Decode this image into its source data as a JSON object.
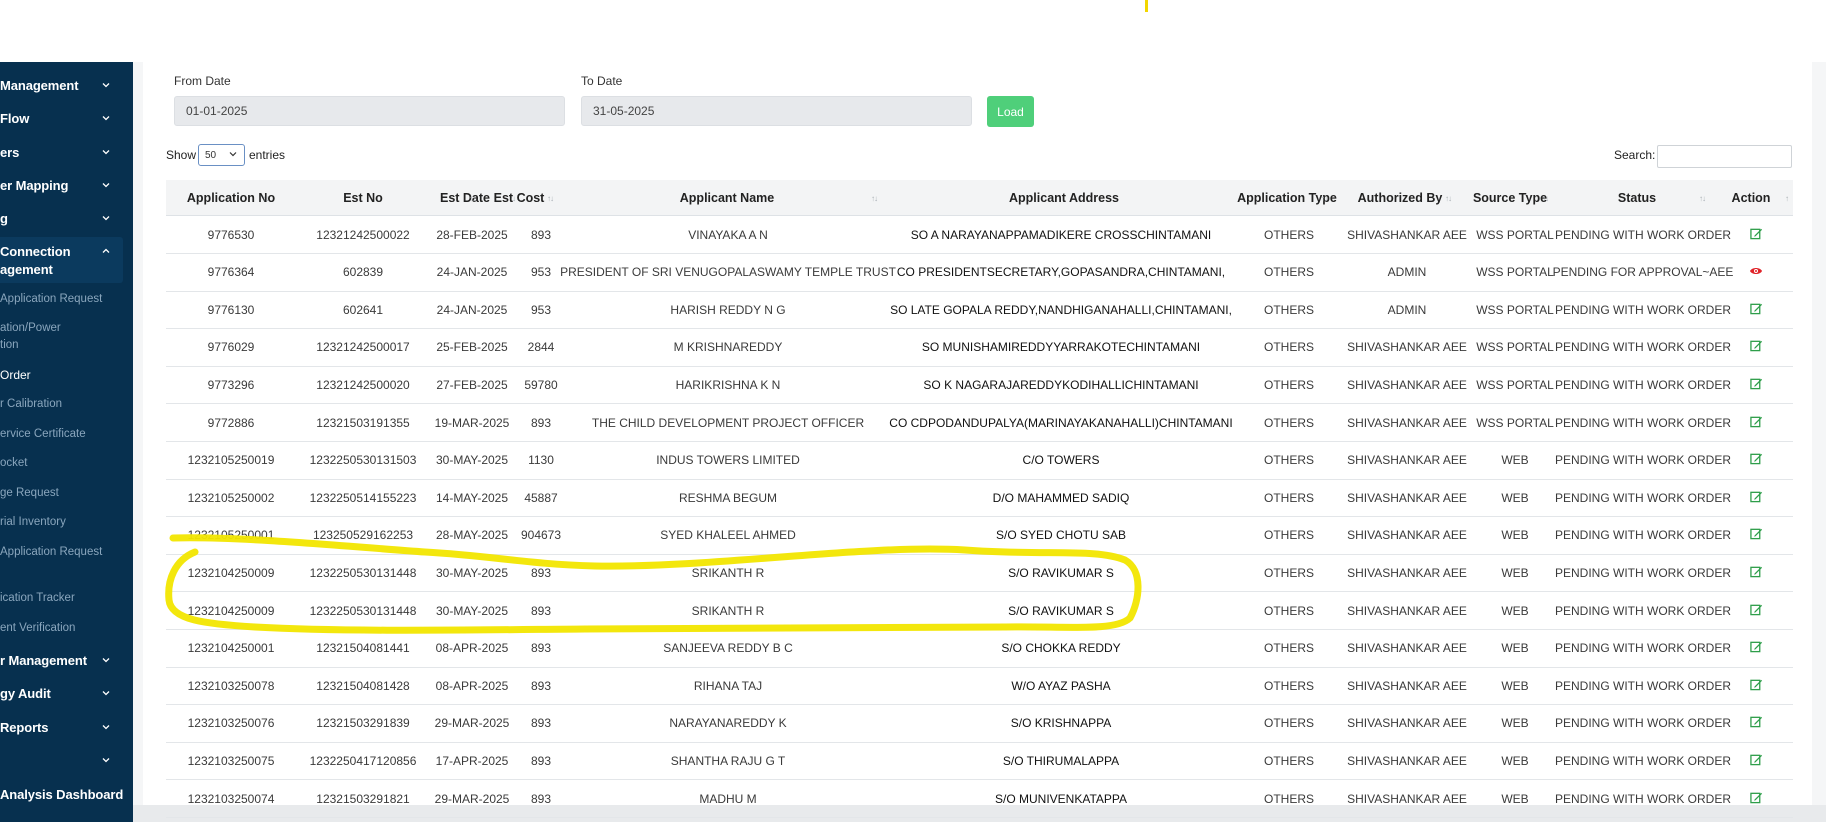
{
  "sidebar": {
    "sections": [
      {
        "label": "Management"
      },
      {
        "label": "Flow"
      },
      {
        "label": "ers"
      },
      {
        "label": "er Mapping"
      },
      {
        "label": "g"
      },
      {
        "label": "Connection",
        "label2": "agement"
      },
      {
        "label": "r Management"
      },
      {
        "label": "gy Audit"
      },
      {
        "label": "Reports"
      },
      {
        "label": ""
      },
      {
        "label": "Analysis Dashboard"
      }
    ],
    "subitems": [
      {
        "label": "Application Request"
      },
      {
        "label": "ation/Power",
        "label2": "tion"
      },
      {
        "label": "Order"
      },
      {
        "label": "r Calibration"
      },
      {
        "label": "ervice Certificate"
      },
      {
        "label": "ocket"
      },
      {
        "label": "ge Request"
      },
      {
        "label": "rial Inventory"
      },
      {
        "label": "Application Request"
      },
      {
        "label": "ication Tracker"
      },
      {
        "label": "ent Verification"
      }
    ]
  },
  "filters": {
    "from_label": "From Date",
    "from_value": "01-01-2025",
    "to_label": "To Date",
    "to_value": "31-05-2025",
    "load_label": "Load"
  },
  "table_controls": {
    "show_label": "Show",
    "page_size": "50",
    "entries_label": "entries",
    "search_label": "Search:"
  },
  "table": {
    "columns": [
      "Application No",
      "Est No",
      "Est Date",
      "Est Cost",
      "Applicant Name",
      "Applicant Address",
      "Application Type",
      "Authorized By",
      "Source Type",
      "Status",
      "Action"
    ],
    "rows": [
      {
        "app_no": "9776530",
        "est_no": "12321242500022",
        "est_date": "28-FEB-2025",
        "est_cost": "893",
        "name": "VINAYAKA A N",
        "address": "SO A NARAYANAPPAMADIKERE CROSSCHINTAMANI",
        "type": "OTHERS",
        "auth": "SHIVASHANKAR AEE",
        "source": "WSS PORTAL",
        "status": "PENDING WITH WORK ORDER",
        "action": "edit-icon"
      },
      {
        "app_no": "9776364",
        "est_no": "602839",
        "est_date": "24-JAN-2025",
        "est_cost": "953",
        "name": "PRESIDENT OF SRI VENUGOPALASWAMY TEMPLE TRUST",
        "address": "CO PRESIDENTSECRETARY,GOPASANDRA,CHINTAMANI,",
        "type": "OTHERS",
        "auth": "ADMIN",
        "source": "WSS PORTAL",
        "status": "PENDING FOR APPROVAL~AEE",
        "action": "eye-icon"
      },
      {
        "app_no": "9776130",
        "est_no": "602641",
        "est_date": "24-JAN-2025",
        "est_cost": "953",
        "name": "HARISH REDDY N G",
        "address": "SO LATE GOPALA REDDY,NANDHIGANAHALLI,CHINTAMANI,",
        "type": "OTHERS",
        "auth": "ADMIN",
        "source": "WSS PORTAL",
        "status": "PENDING WITH WORK ORDER",
        "action": "edit-icon"
      },
      {
        "app_no": "9776029",
        "est_no": "12321242500017",
        "est_date": "25-FEB-2025",
        "est_cost": "2844",
        "name": "M KRISHNAREDDY",
        "address": "SO MUNISHAMIREDDYYARRAKOTECHINTAMANI",
        "type": "OTHERS",
        "auth": "SHIVASHANKAR AEE",
        "source": "WSS PORTAL",
        "status": "PENDING WITH WORK ORDER",
        "action": "edit-icon"
      },
      {
        "app_no": "9773296",
        "est_no": "12321242500020",
        "est_date": "27-FEB-2025",
        "est_cost": "59780",
        "name": "HARIKRISHNA K N",
        "address": "SO K NAGARAJAREDDYKODIHALLICHINTAMANI",
        "type": "OTHERS",
        "auth": "SHIVASHANKAR AEE",
        "source": "WSS PORTAL",
        "status": "PENDING WITH WORK ORDER",
        "action": "edit-icon"
      },
      {
        "app_no": "9772886",
        "est_no": "12321503191355",
        "est_date": "19-MAR-2025",
        "est_cost": "893",
        "name": "THE CHILD DEVELOPMENT PROJECT OFFICER",
        "address": "CO CDPODANDUPALYA(MARINAYAKANAHALLI)CHINTAMANI",
        "type": "OTHERS",
        "auth": "SHIVASHANKAR AEE",
        "source": "WSS PORTAL",
        "status": "PENDING WITH WORK ORDER",
        "action": "edit-icon"
      },
      {
        "app_no": "1232105250019",
        "est_no": "1232250530131503",
        "est_date": "30-MAY-2025",
        "est_cost": "1130",
        "name": "INDUS TOWERS LIMITED",
        "address": "C/O TOWERS",
        "type": "OTHERS",
        "auth": "SHIVASHANKAR AEE",
        "source": "WEB",
        "status": "PENDING WITH WORK ORDER",
        "action": "edit-icon"
      },
      {
        "app_no": "1232105250002",
        "est_no": "1232250514155223",
        "est_date": "14-MAY-2025",
        "est_cost": "45887",
        "name": "RESHMA BEGUM",
        "address": "D/O MAHAMMED SADIQ",
        "type": "OTHERS",
        "auth": "SHIVASHANKAR AEE",
        "source": "WEB",
        "status": "PENDING WITH WORK ORDER",
        "action": "edit-icon"
      },
      {
        "app_no": "1232105250001",
        "est_no": "123250529162253",
        "est_date": "28-MAY-2025",
        "est_cost": "904673",
        "name": "SYED KHALEEL AHMED",
        "address": "S/O SYED CHOTU SAB",
        "type": "OTHERS",
        "auth": "SHIVASHANKAR AEE",
        "source": "WEB",
        "status": "PENDING WITH WORK ORDER",
        "action": "edit-icon"
      },
      {
        "app_no": "1232104250009",
        "est_no": "1232250530131448",
        "est_date": "30-MAY-2025",
        "est_cost": "893",
        "name": "SRIKANTH R",
        "address": "S/O RAVIKUMAR S",
        "type": "OTHERS",
        "auth": "SHIVASHANKAR AEE",
        "source": "WEB",
        "status": "PENDING WITH WORK ORDER",
        "action": "edit-icon"
      },
      {
        "app_no": "1232104250009",
        "est_no": "1232250530131448",
        "est_date": "30-MAY-2025",
        "est_cost": "893",
        "name": "SRIKANTH R",
        "address": "S/O RAVIKUMAR S",
        "type": "OTHERS",
        "auth": "SHIVASHANKAR AEE",
        "source": "WEB",
        "status": "PENDING WITH WORK ORDER",
        "action": "edit-icon"
      },
      {
        "app_no": "1232104250001",
        "est_no": "12321504081441",
        "est_date": "08-APR-2025",
        "est_cost": "893",
        "name": "SANJEEVA REDDY B C",
        "address": "S/O CHOKKA REDDY",
        "type": "OTHERS",
        "auth": "SHIVASHANKAR AEE",
        "source": "WEB",
        "status": "PENDING WITH WORK ORDER",
        "action": "edit-icon"
      },
      {
        "app_no": "1232103250078",
        "est_no": "12321504081428",
        "est_date": "08-APR-2025",
        "est_cost": "893",
        "name": "RIHANA TAJ",
        "address": "W/O AYAZ PASHA",
        "type": "OTHERS",
        "auth": "SHIVASHANKAR AEE",
        "source": "WEB",
        "status": "PENDING WITH WORK ORDER",
        "action": "edit-icon"
      },
      {
        "app_no": "1232103250076",
        "est_no": "12321503291839",
        "est_date": "29-MAR-2025",
        "est_cost": "893",
        "name": "NARAYANAREDDY K",
        "address": "S/O KRISHNAPPA",
        "type": "OTHERS",
        "auth": "SHIVASHANKAR AEE",
        "source": "WEB",
        "status": "PENDING WITH WORK ORDER",
        "action": "edit-icon"
      },
      {
        "app_no": "1232103250075",
        "est_no": "1232250417120856",
        "est_date": "17-APR-2025",
        "est_cost": "893",
        "name": "SHANTHA RAJU G T",
        "address": "S/O THIRUMALAPPA",
        "type": "OTHERS",
        "auth": "SHIVASHANKAR AEE",
        "source": "WEB",
        "status": "PENDING WITH WORK ORDER",
        "action": "edit-icon"
      },
      {
        "app_no": "1232103250074",
        "est_no": "12321503291821",
        "est_date": "29-MAR-2025",
        "est_cost": "893",
        "name": "MADHU M",
        "address": "S/O MUNIVENKATAPPA",
        "type": "OTHERS",
        "auth": "SHIVASHANKAR AEE",
        "source": "WEB",
        "status": "PENDING WITH WORK ORDER",
        "action": "edit-icon"
      }
    ]
  },
  "colors": {
    "sidebar_bg": "#07304f",
    "load_button": "#4fcf7a",
    "edit_icon": "#2e9e4a",
    "view_icon": "#e0242a",
    "highlight_marker": "#f2e600"
  }
}
